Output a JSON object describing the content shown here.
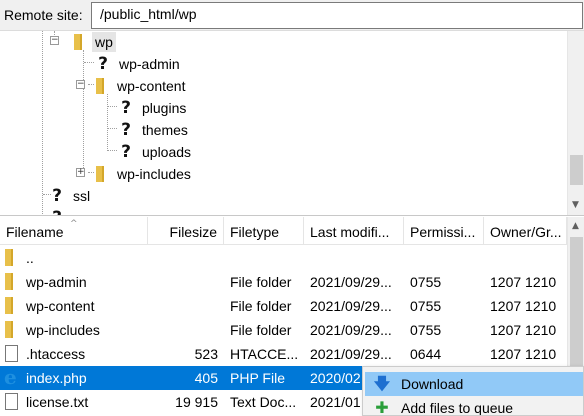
{
  "remote_site": {
    "label": "Remote site:",
    "path": "/public_html/wp"
  },
  "tree": [
    {
      "label": "wp",
      "icon": "folder-icon",
      "toggle": "minus",
      "selected": true
    },
    {
      "label": "wp-admin",
      "icon": "question-icon"
    },
    {
      "label": "wp-content",
      "icon": "folder-icon",
      "toggle": "minus"
    },
    {
      "label": "plugins",
      "icon": "question-icon"
    },
    {
      "label": "themes",
      "icon": "question-icon"
    },
    {
      "label": "uploads",
      "icon": "question-icon"
    },
    {
      "label": "wp-includes",
      "icon": "folder-icon",
      "toggle": "plus"
    },
    {
      "label": "ssl",
      "icon": "question-icon"
    }
  ],
  "file_list": {
    "columns": [
      "Filename",
      "Filesize",
      "Filetype",
      "Last modifi...",
      "Permissi...",
      "Owner/Gr..."
    ],
    "rows": [
      {
        "name": "..",
        "size": "",
        "type": "",
        "modified": "",
        "perms": "",
        "owner": "",
        "icon": "folder-icon"
      },
      {
        "name": "wp-admin",
        "size": "",
        "type": "File folder",
        "modified": "2021/09/29...",
        "perms": "0755",
        "owner": "1207 1210",
        "icon": "folder-icon"
      },
      {
        "name": "wp-content",
        "size": "",
        "type": "File folder",
        "modified": "2021/09/29...",
        "perms": "0755",
        "owner": "1207 1210",
        "icon": "folder-icon"
      },
      {
        "name": "wp-includes",
        "size": "",
        "type": "File folder",
        "modified": "2021/09/29...",
        "perms": "0755",
        "owner": "1207 1210",
        "icon": "folder-icon"
      },
      {
        "name": ".htaccess",
        "size": "523",
        "type": "HTACCE...",
        "modified": "2021/09/29...",
        "perms": "0644",
        "owner": "1207 1210",
        "icon": "document-icon"
      },
      {
        "name": "index.php",
        "size": "405",
        "type": "PHP File",
        "modified": "2020/02",
        "perms": "",
        "owner": "",
        "icon": "ie-icon",
        "selected": true
      },
      {
        "name": "license.txt",
        "size": "19 915",
        "type": "Text Doc...",
        "modified": "2021/01",
        "perms": "",
        "owner": "",
        "icon": "document-icon"
      }
    ]
  },
  "context_menu": {
    "items": [
      {
        "label": "Download",
        "icon": "download-icon",
        "highlighted": true
      },
      {
        "label": "Add files to queue",
        "icon": "add-to-queue-icon"
      }
    ]
  },
  "colors": {
    "selection": "#0078d7",
    "menu_highlight": "#91c9f7",
    "folder": "#e8c04a"
  }
}
